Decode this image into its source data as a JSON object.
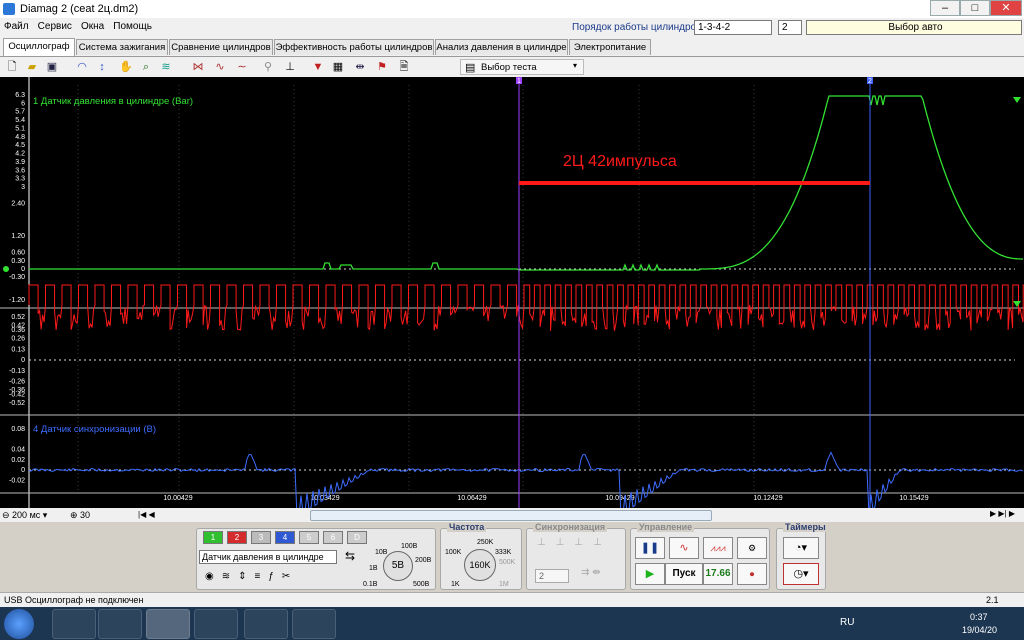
{
  "window": {
    "title": "Diamag 2 (ceat 2ц.dm2)",
    "min": "–",
    "max": "□",
    "close": "✕"
  },
  "menu": [
    "Файл",
    "Сервис",
    "Окна",
    "Помощь"
  ],
  "topbar": {
    "firing_order_label": "Порядок работы цилиндров",
    "firing_order_value": "1-3-4-2",
    "cylinder_value": "2",
    "select_auto": "Выбор авто"
  },
  "tabs": [
    "Осциллограф",
    "Система зажигания",
    "Сравнение цилиндров",
    "Эффективность работы цилиндров",
    "Анализ давления в цилиндре",
    "Электропитание"
  ],
  "toolbar": {
    "test_select": "Выбор теста"
  },
  "scope": {
    "ch1_label": "1 Датчик давления в цилиндре (Bar)",
    "ch4_label": "4 Датчик синхронизации (В)",
    "annotation": "2Ц 42импульса",
    "cursor1": "1",
    "cursor2": "2",
    "ch1_ticks": [
      "6.3",
      "6",
      "5.7",
      "5.4",
      "5.1",
      "4.8",
      "4.5",
      "4.2",
      "3.9",
      "3.6",
      "3.3",
      "3",
      "2.40",
      "1.20",
      "0.60",
      "0.30",
      "0",
      "-0.30",
      "-1.20"
    ],
    "ch2_ticks": [
      "0.52",
      "0.42",
      "0.36",
      "0.26",
      "0.13",
      "0",
      "-0.13",
      "-0.26",
      "-0.36",
      "-0.42",
      "-0.52"
    ],
    "ch4_ticks": [
      "0.08",
      "0.04",
      "0.02",
      "0",
      "-0.02"
    ],
    "time_ticks": [
      "10.00429",
      "10.03429",
      "10.06429",
      "10.09429",
      "10.12429",
      "10.15429"
    ]
  },
  "bottom": {
    "timebase": "200 мс",
    "zoom": "30",
    "channels": [
      "1",
      "2",
      "3",
      "4",
      "5",
      "6",
      "D"
    ],
    "channel_select": "Датчик давления в цилиндре",
    "volt_knob": "5В",
    "volt_ticks": [
      "10В",
      "100В",
      "200В",
      "500В",
      "1В",
      "0.1В"
    ],
    "freq_label": "Частота",
    "freq_knob": "160K",
    "freq_ticks": [
      "100K",
      "250K",
      "333K",
      "500K",
      "1K",
      "1M"
    ],
    "sync_label": "Синхронизация",
    "sync_value": "2",
    "control_label": "Управление",
    "start_button": "Пуск",
    "value_display": "17.66",
    "timers_label": "Таймеры"
  },
  "status": {
    "left": "USB Осциллограф не подключен",
    "right": "2.1"
  },
  "taskbar": {
    "lang": "RU",
    "time": "0:37",
    "date": "19/04/20"
  },
  "colors": {
    "ch1": "#33e133",
    "ch2": "#ff1a1a",
    "ch4": "#3d6cff",
    "annotation": "#ff1a1a"
  }
}
